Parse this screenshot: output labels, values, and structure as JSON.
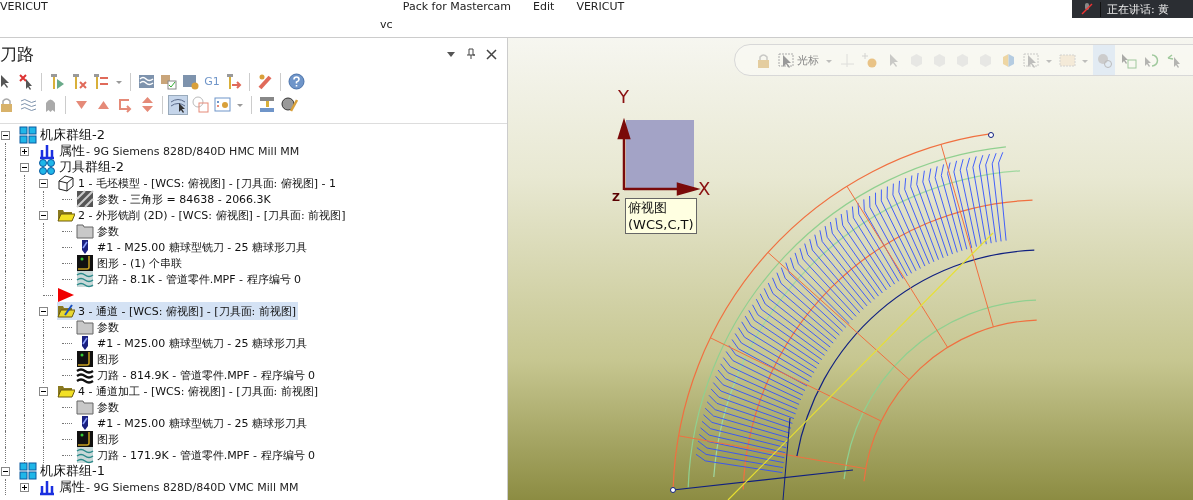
{
  "top_bar": {
    "items": [
      {
        "text": "VERICUT"
      },
      {
        "text": "Pack for Mastercam"
      },
      {
        "text": "Edit"
      },
      {
        "text": "VERICUT"
      }
    ],
    "subtitle": "vc"
  },
  "notification": {
    "text": "正在讲话: 黄"
  },
  "panel": {
    "title": "刀路"
  },
  "toolbar_rows": [
    [
      [
        {
          "selected": false
        },
        {
          "selected": false
        }
      ],
      [
        {
          "selected": false
        },
        {
          "selected": false
        },
        {
          "selected": false
        },
        {
          "selected": false
        }
      ],
      [
        {
          "selected": false
        },
        {
          "selected": false
        },
        {
          "selected": false
        },
        {
          "text": "G1",
          "selected": false
        },
        {
          "selected": false
        }
      ],
      [
        {
          "selected": false
        }
      ],
      [
        {
          "selected": false
        }
      ]
    ],
    [
      [
        {
          "selected": false
        },
        {
          "selected": false
        },
        {
          "selected": false
        }
      ],
      [
        {
          "selected": false
        },
        {
          "selected": false
        },
        {
          "selected": false
        },
        {
          "selected": false
        }
      ],
      [
        {
          "selected": true
        },
        {
          "selected": false
        },
        {
          "selected": false
        },
        {
          "selected": false
        }
      ],
      [
        {
          "selected": false
        },
        {
          "selected": false
        }
      ]
    ]
  ],
  "tree": [
    {
      "kind": "machine",
      "label": "机床群组-2",
      "expanded": true,
      "selected": false,
      "children": [
        {
          "kind": "properties",
          "label": "属性",
          "detail": "- 9G Siemens 828D/840D HMC Mill MM",
          "expanded": false,
          "selected": false
        },
        {
          "kind": "toolgroup",
          "label": "刀具群组-2",
          "expanded": true,
          "selected": false,
          "children": [
            {
              "kind": "stock",
              "label": "1 - 毛坯模型 - [WCS: 俯视图] - [刀具面: 俯视图] - 1",
              "expanded": true,
              "selected": false,
              "children": [
                {
                  "kind": "mesh",
                  "label": "参数 - 三角形 =  84638 - 2066.3K",
                  "selected": false
                }
              ]
            },
            {
              "kind": "operation",
              "label": "2 - 外形铣削 (2D) - [WCS: 俯视图] - [刀具面: 前视图]",
              "expanded": true,
              "selected": false,
              "children": [
                {
                  "kind": "parameters",
                  "label": "参数",
                  "selected": false
                },
                {
                  "kind": "tool",
                  "label": "#1 - M25.00 糖球型铣刀 - 25 糖球形刀具",
                  "selected": false
                },
                {
                  "kind": "geometry",
                  "label": "图形 - (1) 个串联",
                  "selected": false
                },
                {
                  "kind": "toolpath",
                  "label": "刀路 - 8.1K - 管道零件.MPF - 程序编号 0",
                  "selected": false
                }
              ]
            },
            {
              "kind": "insertion",
              "selected": false
            },
            {
              "kind": "operation",
              "label": "3 - 通道 - [WCS: 俯视图] - [刀具面: 前视图]",
              "expanded": true,
              "selected": true,
              "children": [
                {
                  "kind": "parameters",
                  "label": "参数",
                  "selected": false
                },
                {
                  "kind": "tool",
                  "label": "#1 - M25.00 糖球型铣刀 - 25 糖球形刀具",
                  "selected": false
                },
                {
                  "kind": "geometry",
                  "label": "图形",
                  "selected": false
                },
                {
                  "kind": "toolpath",
                  "label": "刀路 - 814.9K - 管道零件.MPF - 程序编号 0",
                  "selected": false
                }
              ]
            },
            {
              "kind": "operation",
              "label": "4 - 通道加工 - [WCS: 俯视图] - [刀具面: 前视图]",
              "expanded": true,
              "selected": false,
              "children": [
                {
                  "kind": "parameters",
                  "label": "参数",
                  "selected": false
                },
                {
                  "kind": "tool",
                  "label": "#1 - M25.00 糖球型铣刀 - 25 糖球形刀具",
                  "selected": false
                },
                {
                  "kind": "geometry",
                  "label": "图形",
                  "selected": false
                },
                {
                  "kind": "toolpath",
                  "label": "刀路 - 171.9K - 管道零件.MPF - 程序编号 0",
                  "selected": false
                }
              ]
            }
          ]
        }
      ]
    },
    {
      "kind": "machine",
      "label": "机床群组-1",
      "expanded": true,
      "selected": false,
      "children": [
        {
          "kind": "properties",
          "label": "属性",
          "detail": "- 9G Siemens 828D/840D VMC Mill MM",
          "expanded": false,
          "selected": false
        }
      ]
    }
  ],
  "view_toolbar": {
    "items": [
      {
        "selected": false
      },
      {
        "text": "光标",
        "selected": false
      },
      {
        "selected": false
      },
      {
        "selected": false
      },
      {
        "selected": false
      },
      {
        "selected": false
      },
      {
        "selected": false
      },
      {
        "selected": false
      },
      {
        "selected": false
      },
      {
        "selected": false
      },
      {
        "selected": false
      },
      {
        "selected": false
      },
      {
        "selected": false
      },
      {
        "selected": false
      },
      {
        "selected": false
      },
      {
        "selected": true
      },
      {
        "selected": false
      },
      {
        "selected": false
      },
      {
        "selected": false
      }
    ]
  },
  "axes": {
    "y": "Y",
    "z": "Z",
    "x": "X"
  },
  "view_tooltip": {
    "lines": [
      "俯视图",
      "(WCS,C,T)"
    ]
  }
}
